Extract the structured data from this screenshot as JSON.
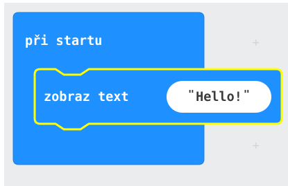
{
  "on_start_block": {
    "label": "při startu",
    "color": "#1e90ff"
  },
  "show_string_block": {
    "label": "zobraz text",
    "value": "Hello!",
    "open_quote": "\"",
    "close_quote": "\"",
    "highlight_color": "#ffff00"
  },
  "workspace": {
    "background": "#ebecee",
    "grid_icon": "+"
  }
}
